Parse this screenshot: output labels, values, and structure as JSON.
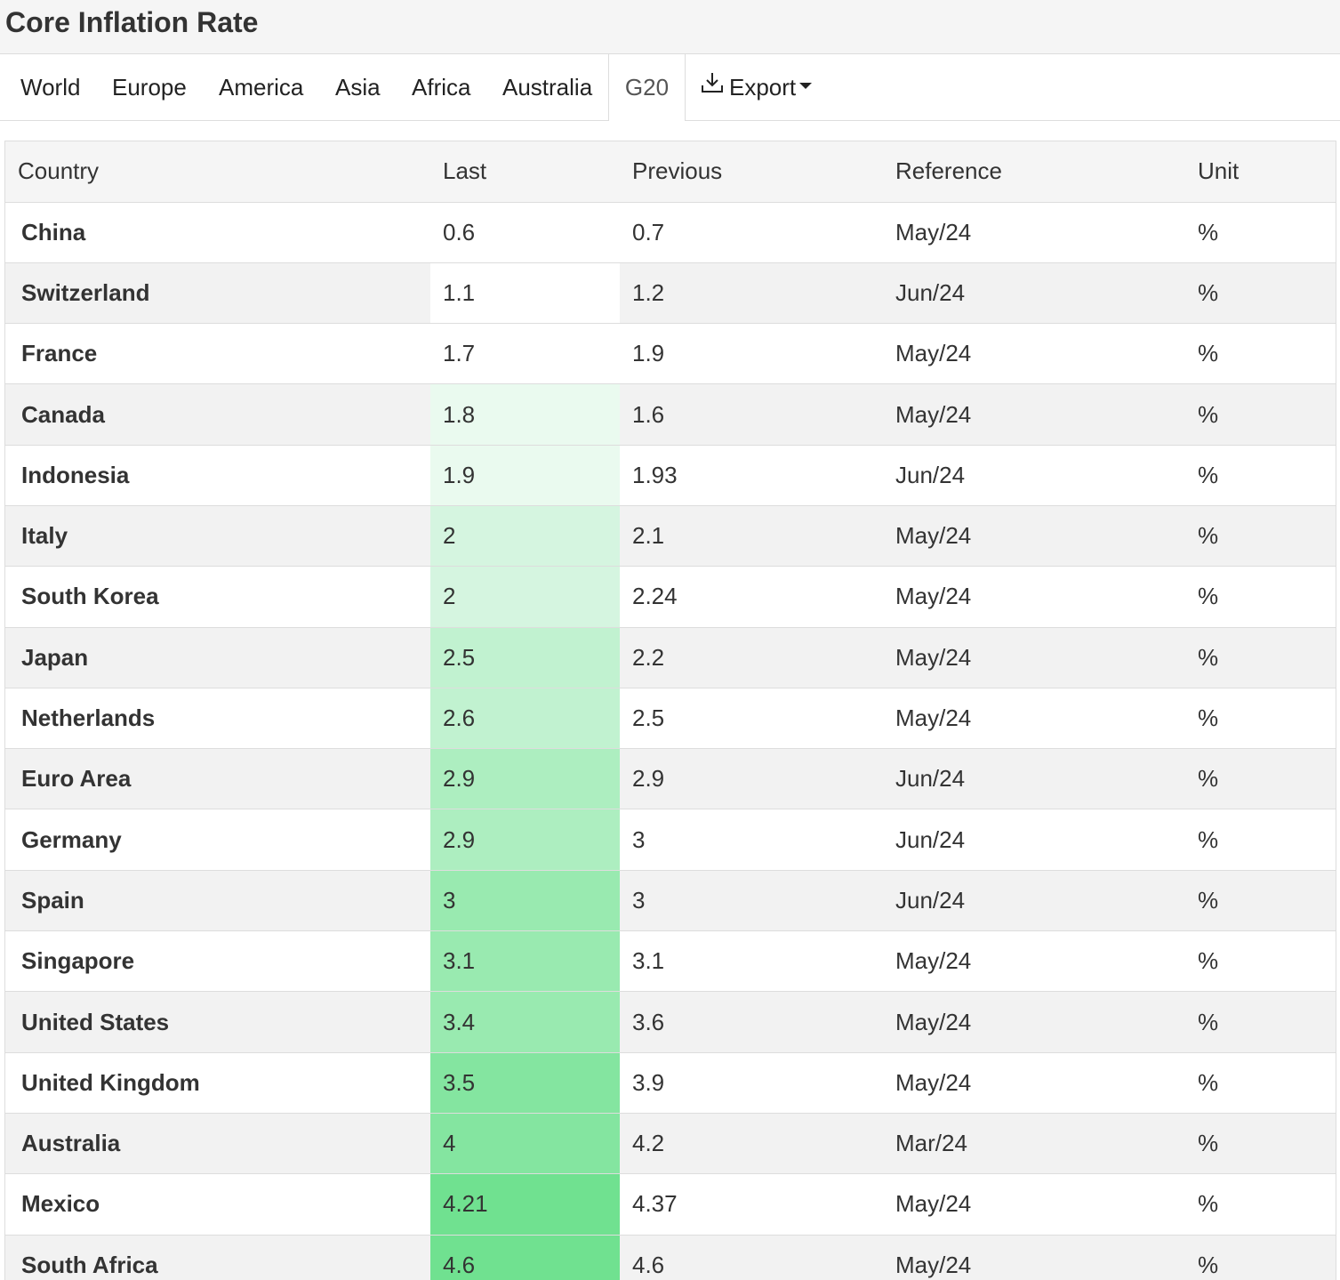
{
  "page": {
    "title": "Core Inflation Rate"
  },
  "tabs": [
    {
      "label": "World"
    },
    {
      "label": "Europe"
    },
    {
      "label": "America"
    },
    {
      "label": "Asia"
    },
    {
      "label": "Africa"
    },
    {
      "label": "Australia"
    },
    {
      "label": "G20",
      "active": true
    }
  ],
  "export": {
    "label": "Export",
    "icon": "download-icon"
  },
  "table": {
    "headers": {
      "country": "Country",
      "last": "Last",
      "previous": "Previous",
      "reference": "Reference",
      "unit": "Unit"
    },
    "rows": [
      {
        "country": "China",
        "last": "0.6",
        "previous": "0.7",
        "reference": "May/24",
        "unit": "%",
        "last_color": "#ffffff"
      },
      {
        "country": "Switzerland",
        "last": "1.1",
        "previous": "1.2",
        "reference": "Jun/24",
        "unit": "%",
        "last_color": "#ffffff"
      },
      {
        "country": "France",
        "last": "1.7",
        "previous": "1.9",
        "reference": "May/24",
        "unit": "%",
        "last_color": "#ffffff"
      },
      {
        "country": "Canada",
        "last": "1.8",
        "previous": "1.6",
        "reference": "May/24",
        "unit": "%",
        "last_color": "#eafaef"
      },
      {
        "country": "Indonesia",
        "last": "1.9",
        "previous": "1.93",
        "reference": "Jun/24",
        "unit": "%",
        "last_color": "#eafaef"
      },
      {
        "country": "Italy",
        "last": "2",
        "previous": "2.1",
        "reference": "May/24",
        "unit": "%",
        "last_color": "#d5f5e0"
      },
      {
        "country": "South Korea",
        "last": "2",
        "previous": "2.24",
        "reference": "May/24",
        "unit": "%",
        "last_color": "#d5f5e0"
      },
      {
        "country": "Japan",
        "last": "2.5",
        "previous": "2.2",
        "reference": "May/24",
        "unit": "%",
        "last_color": "#c1f2d0"
      },
      {
        "country": "Netherlands",
        "last": "2.6",
        "previous": "2.5",
        "reference": "May/24",
        "unit": "%",
        "last_color": "#c1f2d0"
      },
      {
        "country": "Euro Area",
        "last": "2.9",
        "previous": "2.9",
        "reference": "Jun/24",
        "unit": "%",
        "last_color": "#adeec0"
      },
      {
        "country": "Germany",
        "last": "2.9",
        "previous": "3",
        "reference": "Jun/24",
        "unit": "%",
        "last_color": "#adeec0"
      },
      {
        "country": "Spain",
        "last": "3",
        "previous": "3",
        "reference": "Jun/24",
        "unit": "%",
        "last_color": "#99eab0"
      },
      {
        "country": "Singapore",
        "last": "3.1",
        "previous": "3.1",
        "reference": "May/24",
        "unit": "%",
        "last_color": "#99eab0"
      },
      {
        "country": "United States",
        "last": "3.4",
        "previous": "3.6",
        "reference": "May/24",
        "unit": "%",
        "last_color": "#99eab0"
      },
      {
        "country": "United Kingdom",
        "last": "3.5",
        "previous": "3.9",
        "reference": "May/24",
        "unit": "%",
        "last_color": "#84e5a0"
      },
      {
        "country": "Australia",
        "last": "4",
        "previous": "4.2",
        "reference": "Mar/24",
        "unit": "%",
        "last_color": "#84e5a0"
      },
      {
        "country": "Mexico",
        "last": "4.21",
        "previous": "4.37",
        "reference": "May/24",
        "unit": "%",
        "last_color": "#70e190"
      },
      {
        "country": "South Africa",
        "last": "4.6",
        "previous": "4.6",
        "reference": "May/24",
        "unit": "%",
        "last_color": "#70e190"
      }
    ]
  }
}
